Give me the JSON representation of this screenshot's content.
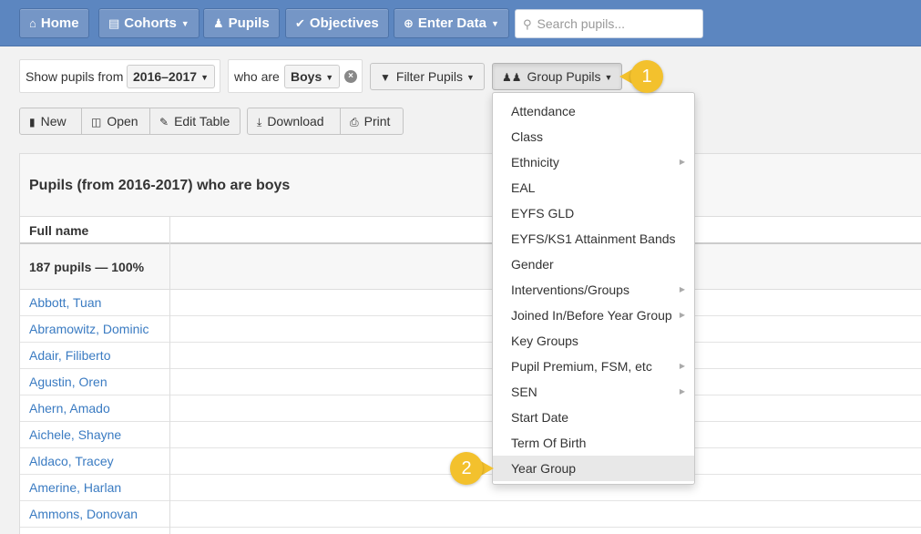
{
  "nav": {
    "home": "Home",
    "cohorts": "Cohorts",
    "pupils": "Pupils",
    "objectives": "Objectives",
    "enter_data": "Enter Data",
    "search_placeholder": "Search pupils...",
    "home_icon": "home-icon",
    "cohorts_icon": "bar-chart-icon",
    "pupils_icon": "user-icon",
    "objectives_icon": "check-circle-icon",
    "enter_data_icon": "plus-circle-icon",
    "search_icon": "search-icon"
  },
  "filters": {
    "show_label": "Show pupils from",
    "year_value": "2016–2017",
    "who_label": "who are",
    "gender_value": "Boys",
    "filter_button": "Filter Pupils",
    "group_button": "Group Pupils"
  },
  "toolbar": {
    "new": "New",
    "open": "Open",
    "edit_table": "Edit Table",
    "download": "Download",
    "print": "Print"
  },
  "table": {
    "caption": "Pupils (from 2016-2017) who are boys",
    "column_full_name": "Full name",
    "summary": "187 pupils — 100%",
    "rows": [
      "Abbott, Tuan",
      "Abramowitz, Dominic",
      "Adair, Filiberto",
      "Agustin, Oren",
      "Ahern, Amado",
      "Aichele, Shayne",
      "Aldaco, Tracey",
      "Amerine, Harlan",
      "Ammons, Donovan"
    ]
  },
  "group_menu": {
    "items": [
      {
        "label": "Attendance",
        "submenu": false
      },
      {
        "label": "Class",
        "submenu": false
      },
      {
        "label": "Ethnicity",
        "submenu": true
      },
      {
        "label": "EAL",
        "submenu": false
      },
      {
        "label": "EYFS GLD",
        "submenu": false
      },
      {
        "label": "EYFS/KS1 Attainment Bands",
        "submenu": false
      },
      {
        "label": "Gender",
        "submenu": false
      },
      {
        "label": "Interventions/Groups",
        "submenu": true
      },
      {
        "label": "Joined In/Before Year Group",
        "submenu": true
      },
      {
        "label": "Key Groups",
        "submenu": false
      },
      {
        "label": "Pupil Premium, FSM, etc",
        "submenu": true
      },
      {
        "label": "SEN",
        "submenu": true
      },
      {
        "label": "Start Date",
        "submenu": false
      },
      {
        "label": "Term Of Birth",
        "submenu": false
      },
      {
        "label": "Year Group",
        "submenu": false,
        "highlighted": true
      }
    ]
  },
  "callouts": {
    "one": "1",
    "two": "2"
  },
  "colors": {
    "nav_bg": "#5c86c0",
    "link": "#3a7bc2",
    "callout": "#f3c12d"
  }
}
